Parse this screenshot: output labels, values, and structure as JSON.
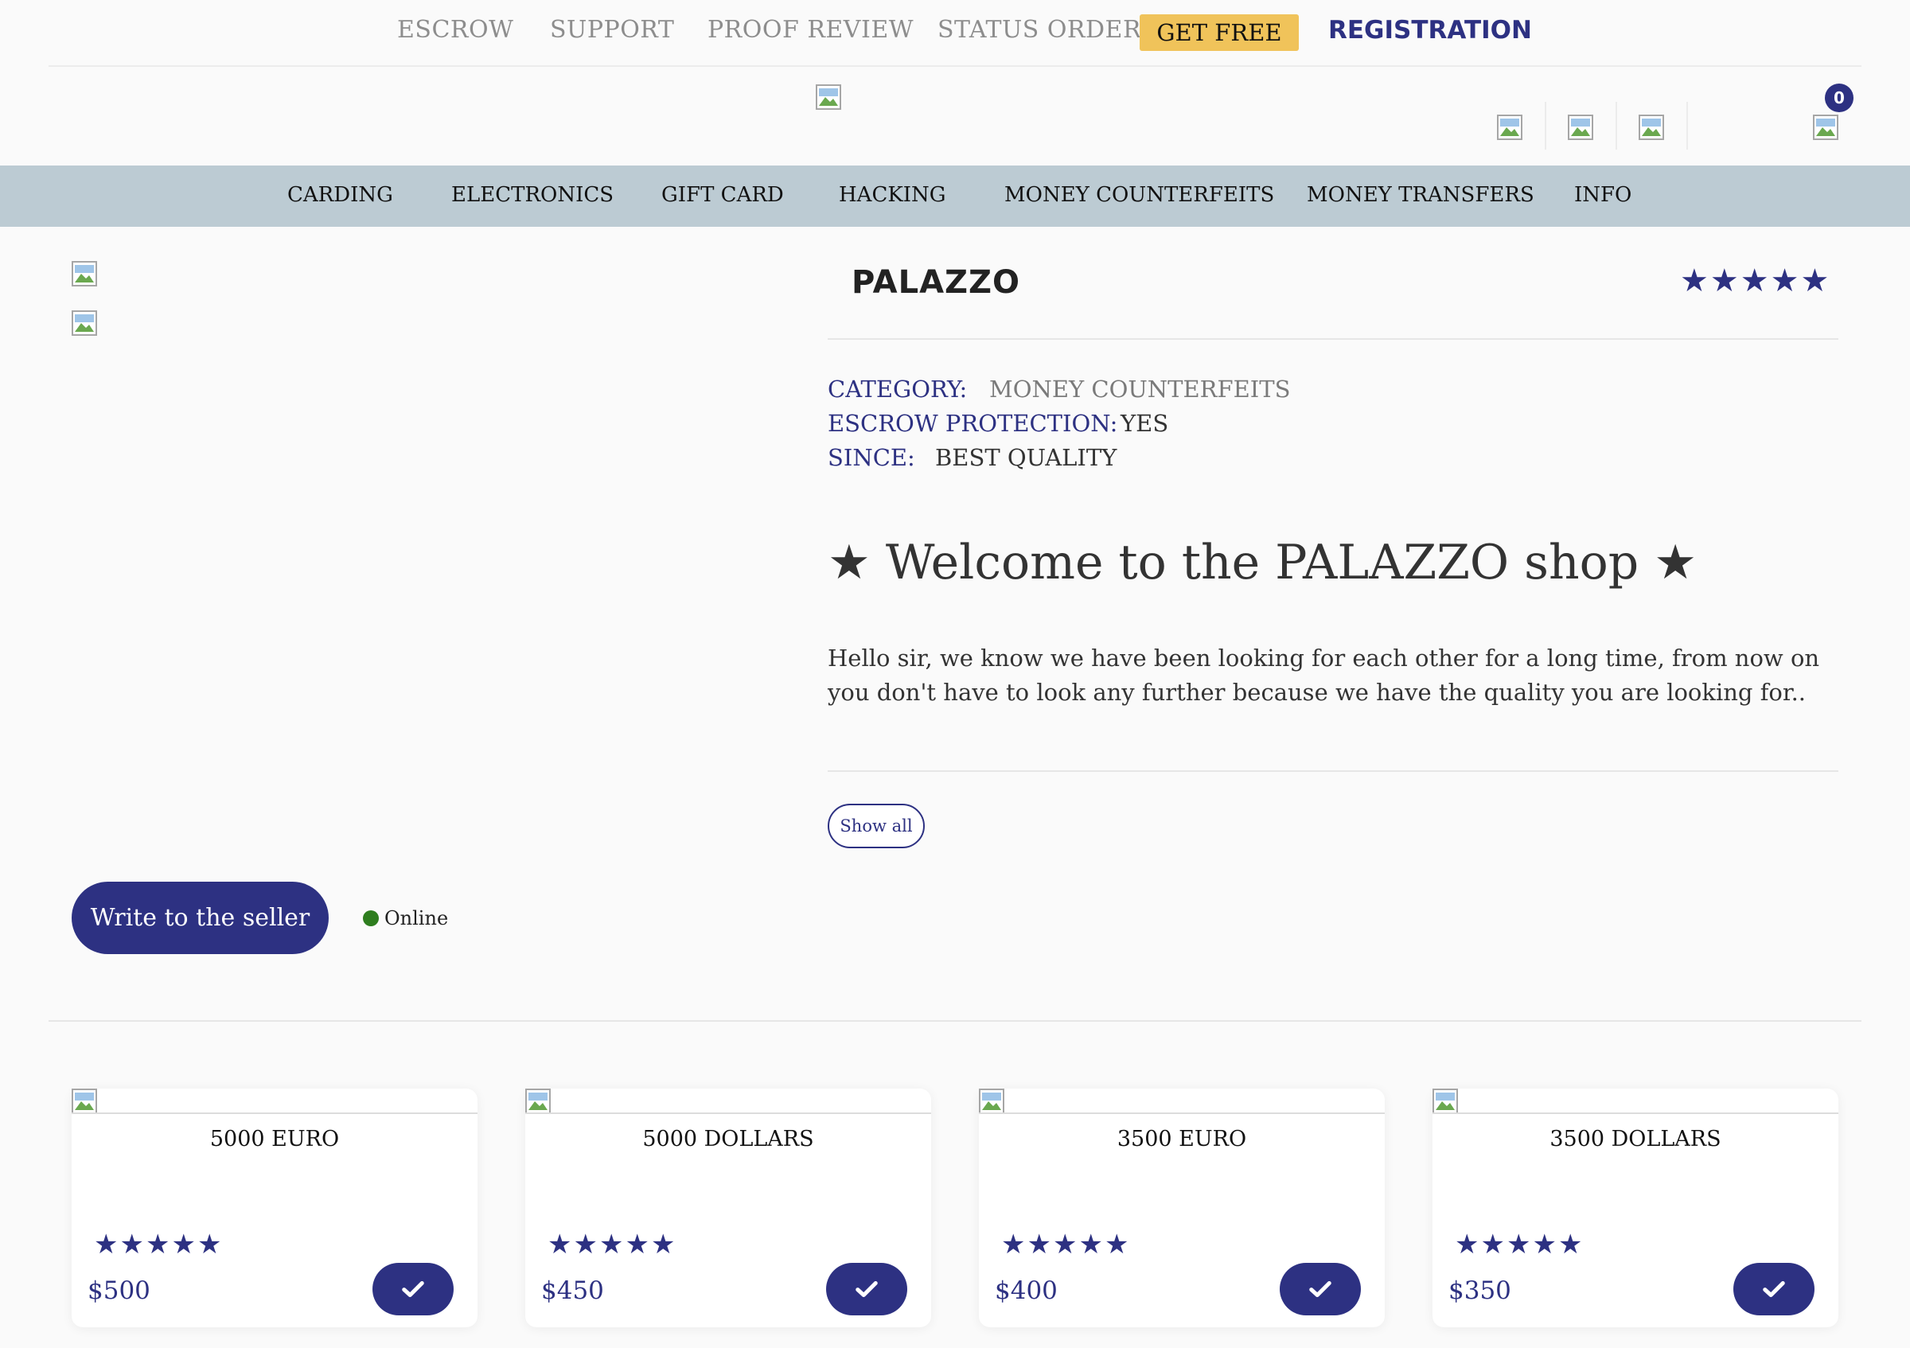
{
  "topnav": {
    "links": [
      "ESCROW",
      "SUPPORT",
      "PROOF REVIEW",
      "STATUS ORDER"
    ],
    "get_free": "GET FREE",
    "registration": "REGISTRATION"
  },
  "header": {
    "cart_count": "0"
  },
  "categories": [
    "CARDING",
    "ELECTRONICS",
    "GIFT CARD",
    "HACKING",
    "MONEY COUNTERFEITS",
    "MONEY TRANSFERS",
    "INFO"
  ],
  "shop": {
    "title": "PALAZZO",
    "rating": 5,
    "category_label": "CATEGORY:",
    "category_value": "MONEY COUNTERFEITS",
    "escrow_label": "ESCROW PROTECTION:",
    "escrow_value": "YES",
    "since_label": "SINCE:",
    "since_value": "BEST QUALITY",
    "welcome": "★ Welcome to the PALAZZO shop ★",
    "description": "Hello sir, we know we have been looking for each other for a long time, from now on you don't have to look any further because we have the quality you are looking for..",
    "show_all": "Show all",
    "write_seller": "Write to the seller",
    "status": "Online"
  },
  "products": [
    {
      "title": "5000 EURO",
      "price": "$500",
      "rating": 5
    },
    {
      "title": "5000 DOLLARS",
      "price": "$450",
      "rating": 5
    },
    {
      "title": "3500 EURO",
      "price": "$400",
      "rating": 5
    },
    {
      "title": "3500 DOLLARS",
      "price": "$350",
      "rating": 5
    }
  ],
  "colors": {
    "accent": "#2d3182",
    "get_free_bg": "#f0c35a",
    "category_bar": "#bccbd3",
    "online": "#2e7d1e"
  }
}
